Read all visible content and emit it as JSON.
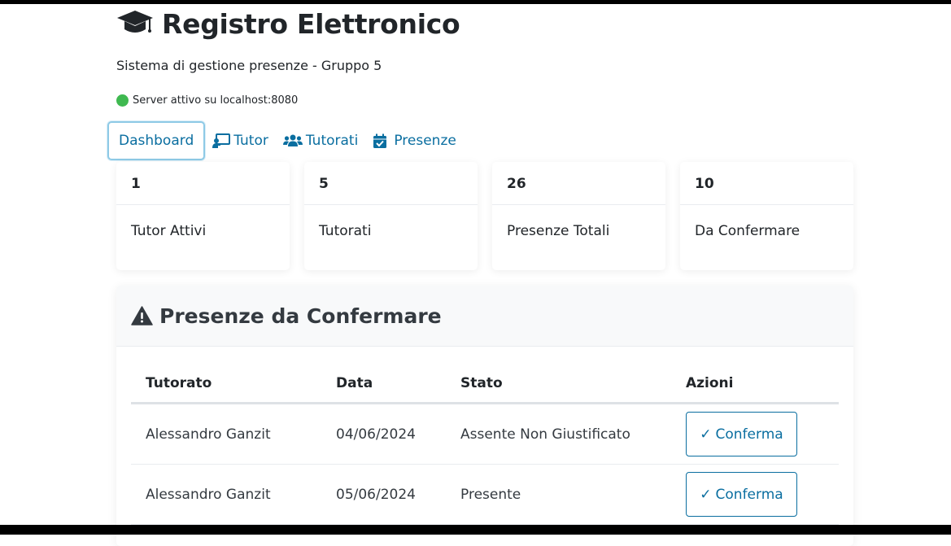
{
  "app": {
    "title": "Registro Elettronico",
    "subtitle": "Sistema di gestione presenze - Gruppo 5",
    "server_status": "Server attivo su localhost:8080",
    "status_color": "#3fb950",
    "accent_color": "#0a6ea0"
  },
  "nav": {
    "items": [
      {
        "label": "Dashboard",
        "icon": "",
        "active": true
      },
      {
        "label": "Tutor",
        "icon": "chalkboard-teacher-icon"
      },
      {
        "label": "Tutorati",
        "icon": "users-icon"
      },
      {
        "label": "Presenze",
        "icon": "calendar-check-icon"
      }
    ]
  },
  "stats": [
    {
      "value": "1",
      "label": "Tutor Attivi"
    },
    {
      "value": "5",
      "label": "Tutorati"
    },
    {
      "value": "26",
      "label": "Presenze Totali"
    },
    {
      "value": "10",
      "label": "Da Confermare"
    }
  ],
  "pending": {
    "title": "Presenze da Confermare",
    "columns": [
      "Tutorato",
      "Data",
      "Stato",
      "Azioni"
    ],
    "rows": [
      {
        "tutorato": "Alessandro Ganzit",
        "data": "04/06/2024",
        "stato": "Assente Non Giustificato",
        "azione": "Conferma"
      },
      {
        "tutorato": "Alessandro Ganzit",
        "data": "05/06/2024",
        "stato": "Presente",
        "azione": "Conferma"
      }
    ]
  }
}
